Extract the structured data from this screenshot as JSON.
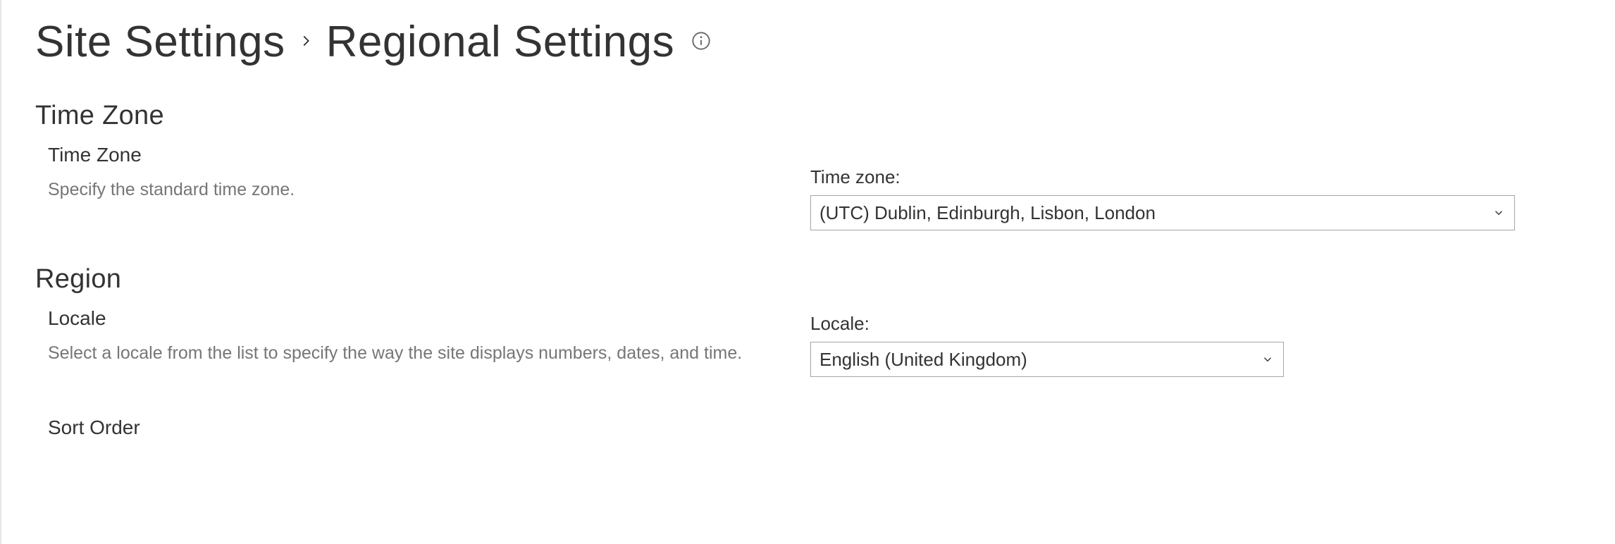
{
  "breadcrumb": {
    "parent": "Site Settings",
    "current": "Regional Settings"
  },
  "sections": {
    "timezone": {
      "title": "Time Zone",
      "sub_title": "Time Zone",
      "description": "Specify the standard time zone.",
      "field_label": "Time zone:",
      "selected": "(UTC) Dublin, Edinburgh, Lisbon, London"
    },
    "region": {
      "title": "Region",
      "locale": {
        "sub_title": "Locale",
        "description": "Select a locale from the list to specify the way the site displays numbers, dates, and time.",
        "field_label": "Locale:",
        "selected": "English (United Kingdom)"
      },
      "sort_order": {
        "sub_title": "Sort Order"
      }
    }
  }
}
